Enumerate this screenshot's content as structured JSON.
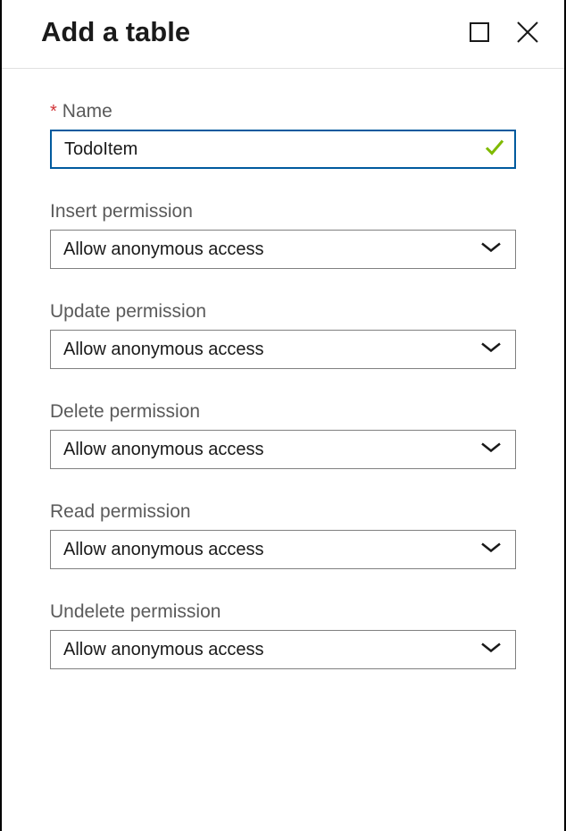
{
  "header": {
    "title": "Add a table"
  },
  "form": {
    "name": {
      "label": "Name",
      "value": "TodoItem",
      "required": true
    },
    "insert": {
      "label": "Insert permission",
      "value": "Allow anonymous access"
    },
    "update": {
      "label": "Update permission",
      "value": "Allow anonymous access"
    },
    "delete": {
      "label": "Delete permission",
      "value": "Allow anonymous access"
    },
    "read": {
      "label": "Read permission",
      "value": "Allow anonymous access"
    },
    "undelete": {
      "label": "Undelete permission",
      "value": "Allow anonymous access"
    }
  }
}
